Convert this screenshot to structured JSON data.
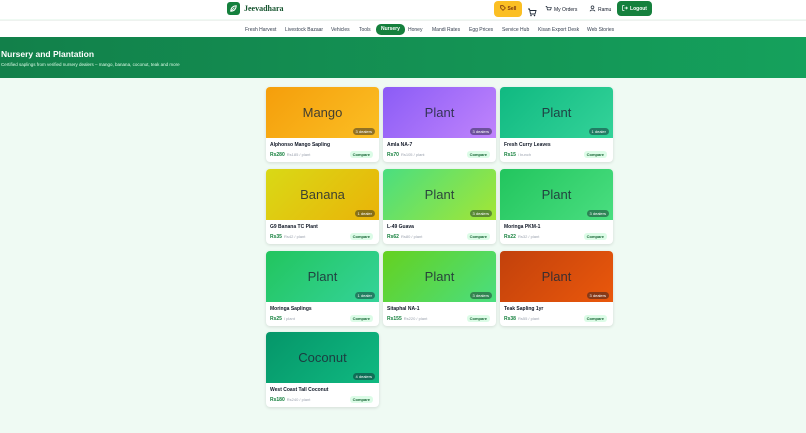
{
  "brand": {
    "name": "Jeevadhara",
    "icon": "leaf-icon"
  },
  "header": {
    "sell_label": "Sell",
    "my_orders_label": "My Orders",
    "user_name": "Ramu",
    "logout_label": "Logout"
  },
  "nav": {
    "items": [
      {
        "label": "Fresh Harvest"
      },
      {
        "label": "Livestock Bazaar"
      },
      {
        "label": "Vehicles"
      },
      {
        "label": "Tools"
      },
      {
        "label": "Nursery"
      },
      {
        "label": "Honey"
      },
      {
        "label": "Mandi Rates"
      },
      {
        "label": "Egg Prices"
      },
      {
        "label": "Service Hub"
      },
      {
        "label": "Kisan Export Desk"
      },
      {
        "label": "Web Stories"
      }
    ],
    "active": "Nursery"
  },
  "banner": {
    "title": "Nursery and Plantation",
    "subtitle": "Certified saplings from verified nursery dealers – mango, banana, coconut, teak and more"
  },
  "colors": {
    "primary": "#15803d",
    "sell": "#fbbf24",
    "compare_bg": "#dcfce7"
  },
  "products": [
    {
      "image_label": "Mango",
      "dealers": "3 dealers",
      "name": "Alphonso Mango Sapling",
      "price": "Rs280",
      "unit": "Rs185 / plant",
      "compare_label": "Compare",
      "gradient": [
        "#f59e0b",
        "#fbbf24"
      ]
    },
    {
      "image_label": "Plant",
      "dealers": "3 dealers",
      "name": "Amla NA-7",
      "price": "Rs70",
      "unit": "Rs105 / plant",
      "compare_label": "Compare",
      "gradient": [
        "#8b5cf6",
        "#c084fc"
      ]
    },
    {
      "image_label": "Plant",
      "dealers": "1 dealer",
      "name": "Fresh Curry Leaves",
      "price": "Rs15",
      "unit": "/ bunch",
      "compare_label": "Compare",
      "gradient": [
        "#10b981",
        "#34d399"
      ]
    },
    {
      "image_label": "Banana",
      "dealers": "1 dealer",
      "name": "G9 Banana TC Plant",
      "price": "Rs35",
      "unit": "Rs42 / plant",
      "compare_label": "Compare",
      "gradient": [
        "#d9d916",
        "#eab308"
      ]
    },
    {
      "image_label": "Plant",
      "dealers": "3 dealers",
      "name": "L-49 Guava",
      "price": "Rs62",
      "unit": "Rs80 / plant",
      "compare_label": "Compare",
      "gradient": [
        "#4ade80",
        "#a3e635"
      ]
    },
    {
      "image_label": "Plant",
      "dealers": "3 dealers",
      "name": "Moringa PKM-1",
      "price": "Rs22",
      "unit": "Rs32 / plant",
      "compare_label": "Compare",
      "gradient": [
        "#22c55e",
        "#4ade80"
      ]
    },
    {
      "image_label": "Plant",
      "dealers": "1 dealer",
      "name": "Moringa Saplings",
      "price": "Rs25",
      "unit": "/ plant",
      "compare_label": "Compare",
      "gradient": [
        "#22c55e",
        "#34d399"
      ]
    },
    {
      "image_label": "Plant",
      "dealers": "3 dealers",
      "name": "Sitaphal NA-1",
      "price": "Rs155",
      "unit": "Rs220 / plant",
      "compare_label": "Compare",
      "gradient": [
        "#65d11f",
        "#4ade80"
      ]
    },
    {
      "image_label": "Plant",
      "dealers": "3 dealers",
      "name": "Teak Sapling 1yr",
      "price": "Rs38",
      "unit": "Rs55 / plant",
      "compare_label": "Compare",
      "gradient": [
        "#c2410c",
        "#ea580c"
      ]
    },
    {
      "image_label": "Coconut",
      "dealers": "4 dealers",
      "name": "West Coast Tall Coconut",
      "price": "Rs180",
      "unit": "Rs240 / plant",
      "compare_label": "Compare",
      "gradient": [
        "#059669",
        "#10b981"
      ]
    }
  ]
}
